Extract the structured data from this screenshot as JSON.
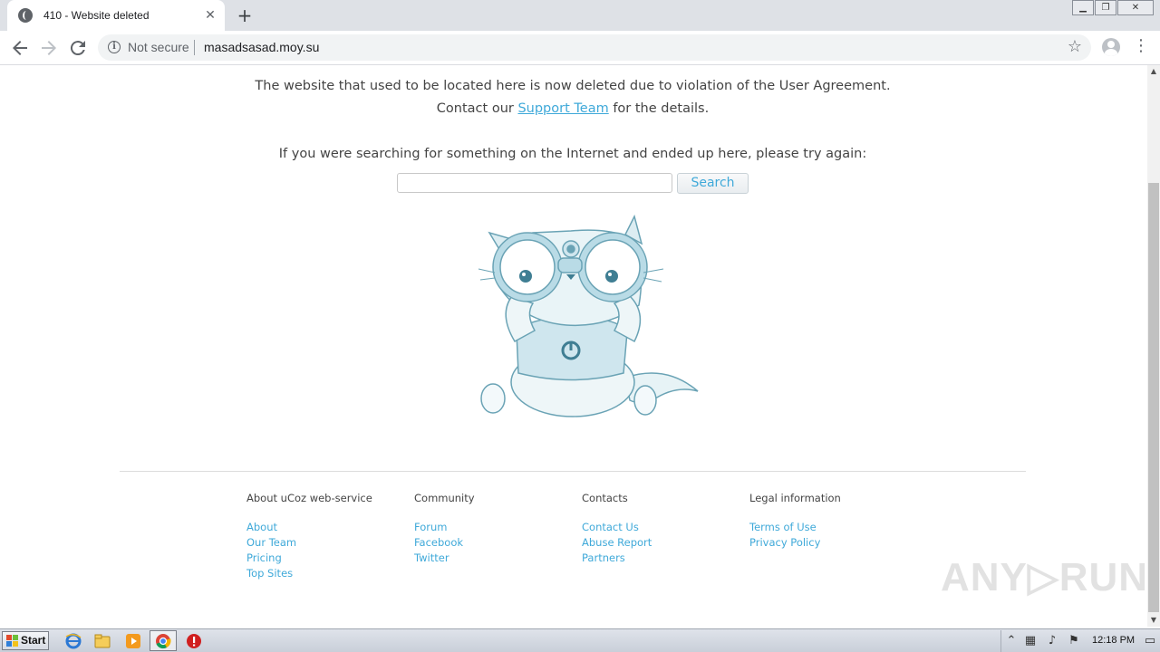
{
  "browser": {
    "tab_title": "410 - Website deleted",
    "tab_close": "✕",
    "new_tab": "+",
    "window_controls": [
      "▁",
      "❐",
      "✕"
    ],
    "security_label": "Not secure",
    "url": "masadsasad.moy.su"
  },
  "page": {
    "message_line1": "The website that used to be located here is now deleted due to violation of the User Agreement.",
    "message_line2_before": "Contact our ",
    "support_link": "Support Team",
    "message_line2_after": " for the details.",
    "search_prompt": "If you were searching for something on the Internet and ended up here, please try again:",
    "search_value": "",
    "search_button": "Search",
    "accent_color": "#3fa9d9"
  },
  "footer": {
    "columns": [
      {
        "heading": "About uCoz web-service",
        "links": [
          "About",
          "Our Team",
          "Pricing",
          "Top Sites"
        ]
      },
      {
        "heading": "Community",
        "links": [
          "Forum",
          "Facebook",
          "Twitter"
        ]
      },
      {
        "heading": "Contacts",
        "links": [
          "Contact Us",
          "Abuse Report",
          "Partners"
        ]
      },
      {
        "heading": "Legal information",
        "links": [
          "Terms of Use",
          "Privacy Policy"
        ]
      }
    ]
  },
  "watermark": "ANY▷RUN",
  "taskbar": {
    "start_label": "Start",
    "clock": "12:18 PM",
    "icons": [
      "internet-explorer-icon",
      "explorer-folder-icon",
      "media-player-icon",
      "chrome-icon",
      "stop-icon"
    ]
  }
}
